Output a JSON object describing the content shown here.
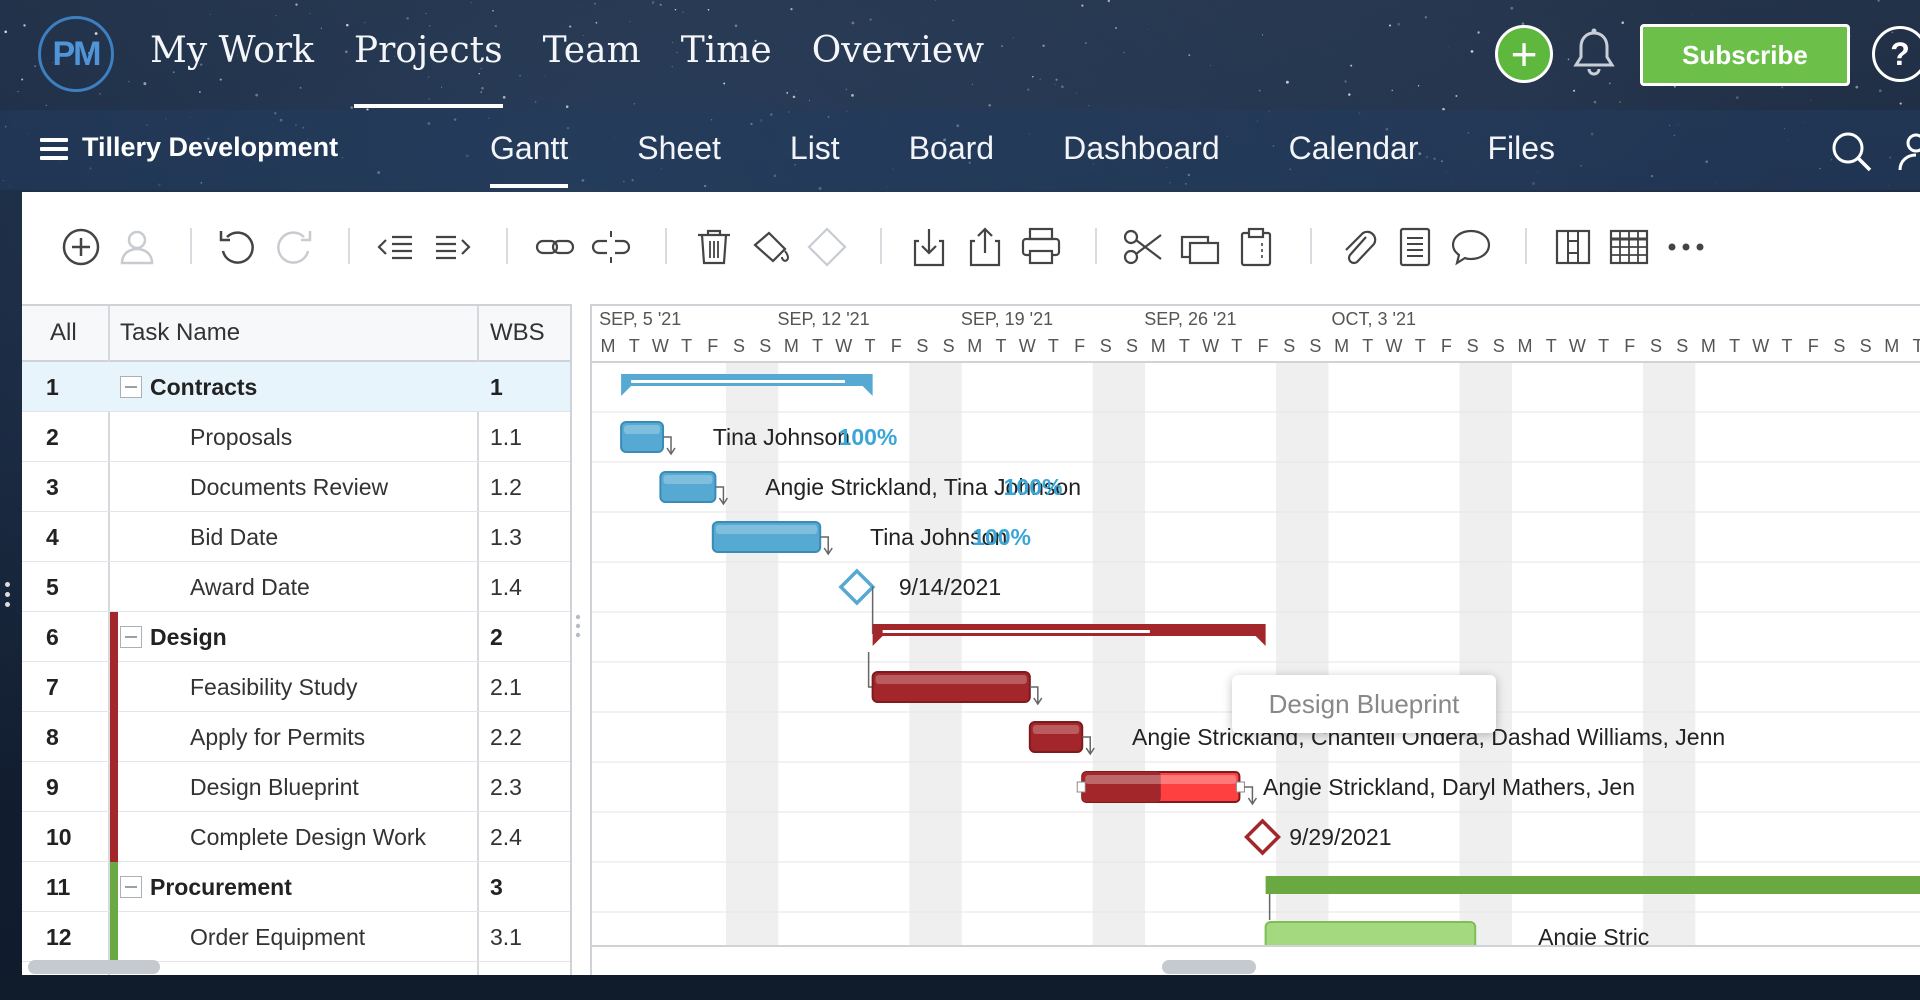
{
  "nav": {
    "logo": "PM",
    "links": [
      "My Work",
      "Projects",
      "Team",
      "Time",
      "Overview"
    ],
    "active": "Projects",
    "subscribe_label": "Subscribe",
    "help_label": "?"
  },
  "subnav": {
    "project_name": "Tillery Development",
    "tabs": [
      "Gantt",
      "Sheet",
      "List",
      "Board",
      "Dashboard",
      "Calendar",
      "Files"
    ],
    "active": "Gantt"
  },
  "toolbar": {
    "icons": [
      "add-task-icon",
      "assign-user-icon",
      "undo-icon",
      "redo-icon",
      "outdent-icon",
      "indent-icon",
      "link-icon",
      "unlink-icon",
      "delete-icon",
      "fill-color-icon",
      "milestone-icon",
      "import-icon",
      "export-icon",
      "print-icon",
      "cut-icon",
      "copy-icon",
      "paste-icon",
      "attachment-icon",
      "notes-icon",
      "comment-icon",
      "columns-icon",
      "table-icon",
      "more-icon"
    ]
  },
  "grid": {
    "headers": {
      "all": "All",
      "task_name": "Task Name",
      "wbs": "WBS"
    },
    "rows": [
      {
        "num": "1",
        "name": "Contracts",
        "wbs": "1",
        "group": true,
        "color": "#56a9d3"
      },
      {
        "num": "2",
        "name": "Proposals",
        "wbs": "1.1",
        "group": false,
        "color": ""
      },
      {
        "num": "3",
        "name": "Documents Review",
        "wbs": "1.2",
        "group": false,
        "color": ""
      },
      {
        "num": "4",
        "name": "Bid Date",
        "wbs": "1.3",
        "group": false,
        "color": ""
      },
      {
        "num": "5",
        "name": "Award Date",
        "wbs": "1.4",
        "group": false,
        "color": ""
      },
      {
        "num": "6",
        "name": "Design",
        "wbs": "2",
        "group": true,
        "color": "#a3262a"
      },
      {
        "num": "7",
        "name": "Feasibility Study",
        "wbs": "2.1",
        "group": false,
        "color": "#a3262a"
      },
      {
        "num": "8",
        "name": "Apply for Permits",
        "wbs": "2.2",
        "group": false,
        "color": "#a3262a"
      },
      {
        "num": "9",
        "name": "Design Blueprint",
        "wbs": "2.3",
        "group": false,
        "color": "#a3262a"
      },
      {
        "num": "10",
        "name": "Complete Design Work",
        "wbs": "2.4",
        "group": false,
        "color": "#a3262a"
      },
      {
        "num": "11",
        "name": "Procurement",
        "wbs": "3",
        "group": true,
        "color": "#6aa842"
      },
      {
        "num": "12",
        "name": "Order Equipment",
        "wbs": "3.1",
        "group": false,
        "color": "#6aa842"
      }
    ]
  },
  "gantt": {
    "weeks": [
      "SEP, 5 '21",
      "SEP, 12 '21",
      "SEP, 19 '21",
      "SEP, 26 '21",
      "OCT, 3 '21"
    ],
    "day_letters": [
      "M",
      "T",
      "W",
      "T",
      "F",
      "S",
      "S"
    ],
    "labels": {
      "r2_assignee": "Tina Johnson",
      "r2_pct": "100%",
      "r3_assignee": "Angie Strickland, Tina Johnson",
      "r3_pct": "100%",
      "r4_assignee": "Tina Johnson",
      "r4_pct": "100%",
      "r5_date": "9/14/2021",
      "r8_assignee": "Angie Strickland, Chantell Ohdera, Dashad Williams, Jenn",
      "r9_assignee": "Angie Strickland, Daryl Mathers, Jen",
      "r10_date": "9/29/2021",
      "r12_assignee": "Angie Stric"
    },
    "tooltip": "Design Blueprint",
    "colors": {
      "contracts": "#56a9d3",
      "design": "#a3262a",
      "design_light": "#ff4040",
      "procurement": "#6aa842",
      "procurement_light": "#a4d97f",
      "pct": "#3aa6d8"
    }
  }
}
